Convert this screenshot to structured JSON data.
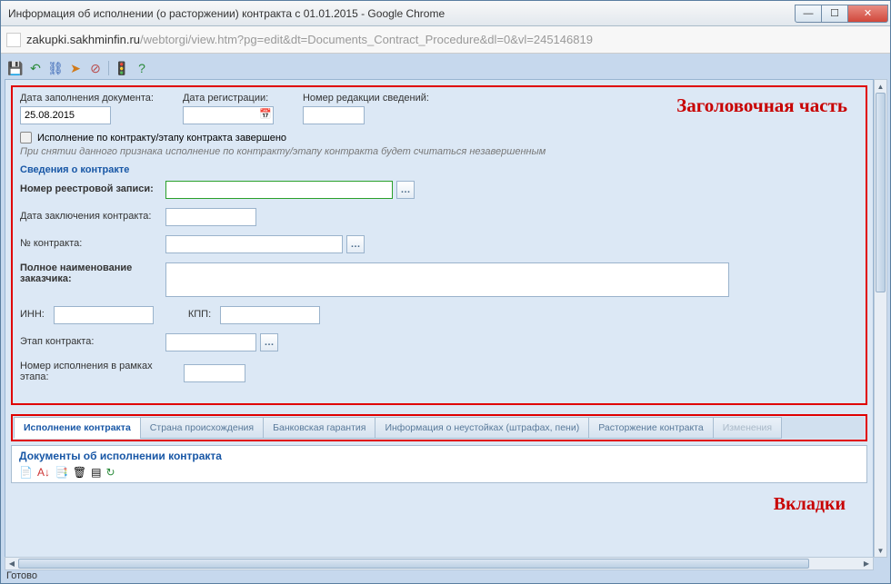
{
  "window": {
    "title": "Информация об исполнении (о расторжении) контракта с 01.01.2015 - Google Chrome"
  },
  "url": {
    "host": "zakupki.sakhminfin.ru",
    "path": "/webtorgi/view.htm?pg=edit&dt=Documents_Contract_Procedure&dl=0&vl=245146819"
  },
  "annotations": {
    "header": "Заголовочная часть",
    "tabs": "Вкладки"
  },
  "header": {
    "fill_date_label": "Дата заполнения документа:",
    "fill_date_value": "25.08.2015",
    "reg_date_label": "Дата регистрации:",
    "reg_date_value": "",
    "revision_label": "Номер редакции сведений:",
    "revision_value": "",
    "checkbox_label": "Исполнение по контракту/этапу контракта завершено",
    "hint": "При снятии данного признака исполнение по контракту/этапу контракта будет считаться незавершенным"
  },
  "contract": {
    "section_title": "Сведения о контракте",
    "registry_label": "Номер реестровой записи:",
    "registry_value": "",
    "date_label": "Дата заключения контракта:",
    "date_value": "",
    "number_label": "№ контракта:",
    "number_value": "",
    "customer_label": "Полное наименование заказчика:",
    "customer_value": "",
    "inn_label": "ИНН:",
    "inn_value": "",
    "kpp_label": "КПП:",
    "kpp_value": "",
    "stage_label": "Этап контракта:",
    "stage_value": "",
    "exec_number_label": "Номер исполнения в рамках этапа:",
    "exec_number_value": ""
  },
  "tabs": [
    "Исполнение контракта",
    "Страна происхождения",
    "Банковская гарантия",
    "Информация о неустойках (штрафах, пени)",
    "Расторжение контракта",
    "Изменения"
  ],
  "sub": {
    "title": "Документы об исполнении контракта"
  },
  "status": "Готово"
}
